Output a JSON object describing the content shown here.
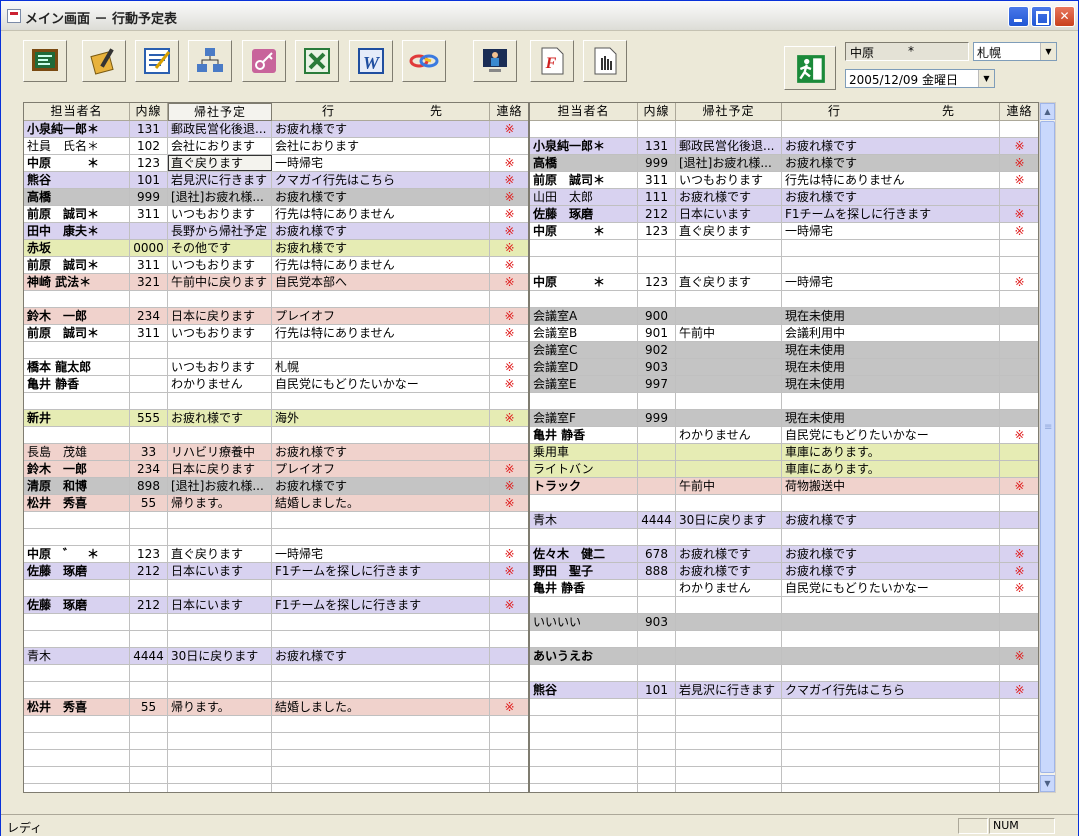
{
  "window": {
    "title": "メイン画面 － 行動予定表"
  },
  "toolbar": {
    "tools": [
      {
        "name": "schedule-board-icon"
      },
      {
        "name": "pen-notebook-icon"
      },
      {
        "name": "checklist-icon"
      },
      {
        "name": "organization-chart-icon"
      },
      {
        "name": "key-icon"
      },
      {
        "name": "excel-icon"
      },
      {
        "name": "word-icon"
      },
      {
        "name": "link-icon"
      },
      {
        "name": "person-monitor-icon"
      },
      {
        "name": "font-document-icon"
      },
      {
        "name": "hand-pointer-icon"
      }
    ],
    "exit_icon": "exit-running-man-icon"
  },
  "header_info": {
    "user_name": "中原",
    "user_mark": "*",
    "location": "札幌",
    "date": "2005/12/09 金曜日"
  },
  "columns": {
    "name": "担当者名",
    "ext": "内線",
    "return": "帰社予定",
    "dest1": "行",
    "dest2": "先",
    "contact": "連絡"
  },
  "left_rows": [
    {
      "bg": "purple",
      "name": "小泉純一郎＊",
      "nb": true,
      "ext": "131",
      "ret": "郵政民営化後退...",
      "dest": "お疲れ様です",
      "mark": "※"
    },
    {
      "bg": "white",
      "name": "社員　氏名＊",
      "nb": false,
      "ext": "102",
      "ret": "会社におります",
      "dest": "会社におります",
      "mark": ""
    },
    {
      "bg": "white",
      "name": "中原　　　＊",
      "nb": true,
      "ext": "123",
      "ret": "直ぐ戻ります",
      "dest": "一時帰宅",
      "mark": "※",
      "boxed": true
    },
    {
      "bg": "purple",
      "name": "熊谷",
      "nb": true,
      "ext": "101",
      "ret": "岩見沢に行きます",
      "dest": "クマガイ行先はこちら",
      "mark": "※"
    },
    {
      "bg": "gray",
      "name": "高橋",
      "nb": true,
      "ext": "999",
      "ret": "[退社]お疲れ様...",
      "dest": "お疲れ様です",
      "mark": "※"
    },
    {
      "bg": "white",
      "name": "前原　誠司＊",
      "nb": true,
      "ext": "311",
      "ret": "いつもおります",
      "dest": "行先は特にありません",
      "mark": "※"
    },
    {
      "bg": "purple",
      "name": "田中　康夫＊",
      "nb": true,
      "ext": "",
      "ret": "長野から帰社予定",
      "dest": "お疲れ様です",
      "mark": "※"
    },
    {
      "bg": "yellow",
      "name": "赤坂",
      "nb": true,
      "ext": "0000",
      "ret": "その他です",
      "dest": "お疲れ様です",
      "mark": "※"
    },
    {
      "bg": "white",
      "name": "前原　誠司＊",
      "nb": true,
      "ext": "311",
      "ret": "いつもおります",
      "dest": "行先は特にありません",
      "mark": "※"
    },
    {
      "bg": "pink",
      "name": "神崎 武法＊",
      "nb": true,
      "ext": "321",
      "ret": "午前中に戻ります",
      "dest": "自民党本部へ",
      "mark": "※"
    },
    {
      "bg": "white",
      "name": "",
      "nb": false,
      "ext": "",
      "ret": "",
      "dest": "",
      "mark": ""
    },
    {
      "bg": "pink",
      "name": "鈴木　一郎",
      "nb": true,
      "ext": "234",
      "ret": "日本に戻ります",
      "dest": "プレイオフ",
      "mark": "※"
    },
    {
      "bg": "white",
      "name": "前原　誠司＊",
      "nb": true,
      "ext": "311",
      "ret": "いつもおります",
      "dest": "行先は特にありません",
      "mark": "※"
    },
    {
      "bg": "white",
      "name": "",
      "nb": false,
      "ext": "",
      "ret": "",
      "dest": "",
      "mark": ""
    },
    {
      "bg": "white",
      "name": "橋本 龍太郎",
      "nb": true,
      "ext": "",
      "ret": "いつもおります",
      "dest": "札幌",
      "mark": "※"
    },
    {
      "bg": "white",
      "name": "亀井 静香",
      "nb": true,
      "ext": "",
      "ret": "わかりません",
      "dest": "自民党にもどりたいかなー",
      "mark": "※"
    },
    {
      "bg": "white",
      "name": "",
      "nb": false,
      "ext": "",
      "ret": "",
      "dest": "",
      "mark": ""
    },
    {
      "bg": "yellow",
      "name": "新井",
      "nb": true,
      "ext": "555",
      "ret": "お疲れ様です",
      "dest": "海外",
      "mark": "※"
    },
    {
      "bg": "white",
      "name": "",
      "nb": false,
      "ext": "",
      "ret": "",
      "dest": "",
      "mark": ""
    },
    {
      "bg": "pink",
      "name": "長島　茂雄",
      "nb": false,
      "ext": "33",
      "ret": "リハビリ療養中",
      "dest": "お疲れ様です",
      "mark": ""
    },
    {
      "bg": "pink",
      "name": "鈴木　一郎",
      "nb": true,
      "ext": "234",
      "ret": "日本に戻ります",
      "dest": "プレイオフ",
      "mark": "※"
    },
    {
      "bg": "gray",
      "name": "清原　和博",
      "nb": true,
      "ext": "898",
      "ret": "[退社]お疲れ様...",
      "dest": "お疲れ様です",
      "mark": "※"
    },
    {
      "bg": "pink",
      "name": "松井　秀喜",
      "nb": true,
      "ext": "55",
      "ret": "帰ります。",
      "dest": "結婚しました。",
      "mark": "※"
    },
    {
      "bg": "white",
      "name": "",
      "nb": false,
      "ext": "",
      "ret": "",
      "dest": "",
      "mark": ""
    },
    {
      "bg": "white",
      "name": "",
      "nb": false,
      "ext": "",
      "ret": "",
      "dest": "",
      "mark": ""
    },
    {
      "bg": "white",
      "name": "中原　゛　＊",
      "nb": true,
      "ext": "123",
      "ret": "直ぐ戻ります",
      "dest": "一時帰宅",
      "mark": "※"
    },
    {
      "bg": "purple",
      "name": "佐藤　琢磨",
      "nb": true,
      "ext": "212",
      "ret": "日本にいます",
      "dest": "F1チームを探しに行きます",
      "mark": "※"
    },
    {
      "bg": "white",
      "name": "",
      "nb": false,
      "ext": "",
      "ret": "",
      "dest": "",
      "mark": ""
    },
    {
      "bg": "purple",
      "name": "佐藤　琢磨",
      "nb": true,
      "ext": "212",
      "ret": "日本にいます",
      "dest": "F1チームを探しに行きます",
      "mark": "※"
    },
    {
      "bg": "white",
      "name": "",
      "nb": false,
      "ext": "",
      "ret": "",
      "dest": "",
      "mark": ""
    },
    {
      "bg": "white",
      "name": "",
      "nb": false,
      "ext": "",
      "ret": "",
      "dest": "",
      "mark": ""
    },
    {
      "bg": "purple",
      "name": "青木",
      "nb": false,
      "ext": "4444",
      "ret": "30日に戻ります",
      "dest": "お疲れ様です",
      "mark": ""
    },
    {
      "bg": "white",
      "name": "",
      "nb": false,
      "ext": "",
      "ret": "",
      "dest": "",
      "mark": ""
    },
    {
      "bg": "white",
      "name": "",
      "nb": false,
      "ext": "",
      "ret": "",
      "dest": "",
      "mark": ""
    },
    {
      "bg": "pink",
      "name": "松井　秀喜",
      "nb": true,
      "ext": "55",
      "ret": "帰ります。",
      "dest": "結婚しました。",
      "mark": "※"
    },
    {
      "bg": "white",
      "name": "",
      "nb": false,
      "ext": "",
      "ret": "",
      "dest": "",
      "mark": ""
    },
    {
      "bg": "white",
      "name": "",
      "nb": false,
      "ext": "",
      "ret": "",
      "dest": "",
      "mark": ""
    },
    {
      "bg": "white",
      "name": "",
      "nb": false,
      "ext": "",
      "ret": "",
      "dest": "",
      "mark": ""
    },
    {
      "bg": "white",
      "name": "",
      "nb": false,
      "ext": "",
      "ret": "",
      "dest": "",
      "mark": ""
    },
    {
      "bg": "white",
      "name": "",
      "nb": false,
      "ext": "",
      "ret": "",
      "dest": "",
      "mark": ""
    },
    {
      "bg": "white",
      "name": "",
      "nb": false,
      "ext": "",
      "ret": "",
      "dest": "",
      "mark": ""
    }
  ],
  "right_rows": [
    {
      "bg": "white",
      "name": "",
      "nb": false,
      "ext": "",
      "ret": "",
      "dest": "",
      "mark": ""
    },
    {
      "bg": "purple",
      "name": "小泉純一郎＊",
      "nb": true,
      "ext": "131",
      "ret": "郵政民営化後退...",
      "dest": "お疲れ様です",
      "mark": "※"
    },
    {
      "bg": "gray",
      "name": "高橋",
      "nb": true,
      "ext": "999",
      "ret": "[退社]お疲れ様...",
      "dest": "お疲れ様です",
      "mark": "※"
    },
    {
      "bg": "white",
      "name": "前原　誠司＊",
      "nb": true,
      "ext": "311",
      "ret": "いつもおります",
      "dest": "行先は特にありません",
      "mark": "※"
    },
    {
      "bg": "purple",
      "name": "山田　太郎",
      "nb": false,
      "ext": "111",
      "ret": "お疲れ様です",
      "dest": "お疲れ様です",
      "mark": ""
    },
    {
      "bg": "purple",
      "name": "佐藤　琢磨",
      "nb": true,
      "ext": "212",
      "ret": "日本にいます",
      "dest": "F1チームを探しに行きます",
      "mark": "※"
    },
    {
      "bg": "white",
      "name": "中原　　　＊",
      "nb": true,
      "ext": "123",
      "ret": "直ぐ戻ります",
      "dest": "一時帰宅",
      "mark": "※"
    },
    {
      "bg": "white",
      "name": "",
      "nb": false,
      "ext": "",
      "ret": "",
      "dest": "",
      "mark": ""
    },
    {
      "bg": "white",
      "name": "",
      "nb": false,
      "ext": "",
      "ret": "",
      "dest": "",
      "mark": ""
    },
    {
      "bg": "white",
      "name": "中原　　　＊",
      "nb": true,
      "ext": "123",
      "ret": "直ぐ戻ります",
      "dest": "一時帰宅",
      "mark": "※"
    },
    {
      "bg": "white",
      "name": "",
      "nb": false,
      "ext": "",
      "ret": "",
      "dest": "",
      "mark": ""
    },
    {
      "bg": "gray",
      "name": "会議室A",
      "nb": false,
      "ext": "900",
      "ret": "",
      "dest": "現在未使用",
      "mark": ""
    },
    {
      "bg": "white",
      "name": "会議室B",
      "nb": false,
      "ext": "901",
      "ret": "午前中",
      "dest": "会議利用中",
      "mark": ""
    },
    {
      "bg": "gray",
      "name": "会議室C",
      "nb": false,
      "ext": "902",
      "ret": "",
      "dest": "現在未使用",
      "mark": ""
    },
    {
      "bg": "gray",
      "name": "会議室D",
      "nb": false,
      "ext": "903",
      "ret": "",
      "dest": "現在未使用",
      "mark": ""
    },
    {
      "bg": "gray",
      "name": "会議室E",
      "nb": false,
      "ext": "997",
      "ret": "",
      "dest": "現在未使用",
      "mark": ""
    },
    {
      "bg": "white",
      "name": "",
      "nb": false,
      "ext": "",
      "ret": "",
      "dest": "",
      "mark": ""
    },
    {
      "bg": "gray",
      "name": "会議室F",
      "nb": false,
      "ext": "999",
      "ret": "",
      "dest": "現在未使用",
      "mark": ""
    },
    {
      "bg": "white",
      "name": "亀井 静香",
      "nb": true,
      "ext": "",
      "ret": "わかりません",
      "dest": "自民党にもどりたいかなー",
      "mark": "※"
    },
    {
      "bg": "yellow",
      "name": "乗用車",
      "nb": false,
      "ext": "",
      "ret": "",
      "dest": "車庫にあります。",
      "mark": ""
    },
    {
      "bg": "yellow",
      "name": "ライトバン",
      "nb": false,
      "ext": "",
      "ret": "",
      "dest": "車庫にあります。",
      "mark": ""
    },
    {
      "bg": "pink",
      "name": "トラック",
      "nb": true,
      "ext": "",
      "ret": "午前中",
      "dest": "荷物搬送中",
      "mark": "※"
    },
    {
      "bg": "white",
      "name": "",
      "nb": false,
      "ext": "",
      "ret": "",
      "dest": "",
      "mark": ""
    },
    {
      "bg": "purple",
      "name": "青木",
      "nb": false,
      "ext": "4444",
      "ret": "30日に戻ります",
      "dest": "お疲れ様です",
      "mark": ""
    },
    {
      "bg": "white",
      "name": "",
      "nb": false,
      "ext": "",
      "ret": "",
      "dest": "",
      "mark": ""
    },
    {
      "bg": "purple",
      "name": "佐々木　健二",
      "nb": true,
      "ext": "678",
      "ret": "お疲れ様です",
      "dest": "お疲れ様です",
      "mark": "※"
    },
    {
      "bg": "purple",
      "name": "野田　聖子",
      "nb": true,
      "ext": "888",
      "ret": "お疲れ様です",
      "dest": "お疲れ様です",
      "mark": "※"
    },
    {
      "bg": "white",
      "name": "亀井 静香",
      "nb": true,
      "ext": "",
      "ret": "わかりません",
      "dest": "自民党にもどりたいかなー",
      "mark": "※"
    },
    {
      "bg": "white",
      "name": "",
      "nb": false,
      "ext": "",
      "ret": "",
      "dest": "",
      "mark": ""
    },
    {
      "bg": "gray",
      "name": "いいいい",
      "nb": false,
      "ext": "903",
      "ret": "",
      "dest": "",
      "mark": ""
    },
    {
      "bg": "white",
      "name": "",
      "nb": false,
      "ext": "",
      "ret": "",
      "dest": "",
      "mark": ""
    },
    {
      "bg": "gray",
      "name": "あいうえお",
      "nb": true,
      "ext": "",
      "ret": "",
      "dest": "",
      "mark": "※"
    },
    {
      "bg": "white",
      "name": "",
      "nb": false,
      "ext": "",
      "ret": "",
      "dest": "",
      "mark": ""
    },
    {
      "bg": "purple",
      "name": "熊谷",
      "nb": true,
      "ext": "101",
      "ret": "岩見沢に行きます",
      "dest": "クマガイ行先はこちら",
      "mark": "※"
    },
    {
      "bg": "white",
      "name": "",
      "nb": false,
      "ext": "",
      "ret": "",
      "dest": "",
      "mark": ""
    },
    {
      "bg": "white",
      "name": "",
      "nb": false,
      "ext": "",
      "ret": "",
      "dest": "",
      "mark": ""
    },
    {
      "bg": "white",
      "name": "",
      "nb": false,
      "ext": "",
      "ret": "",
      "dest": "",
      "mark": ""
    },
    {
      "bg": "white",
      "name": "",
      "nb": false,
      "ext": "",
      "ret": "",
      "dest": "",
      "mark": ""
    },
    {
      "bg": "white",
      "name": "",
      "nb": false,
      "ext": "",
      "ret": "",
      "dest": "",
      "mark": ""
    },
    {
      "bg": "white",
      "name": "",
      "nb": false,
      "ext": "",
      "ret": "",
      "dest": "",
      "mark": ""
    },
    {
      "bg": "white",
      "name": "",
      "nb": false,
      "ext": "",
      "ret": "",
      "dest": "",
      "mark": ""
    }
  ],
  "status": {
    "text": "レディ",
    "num": "NUM"
  },
  "colors": {
    "purple_row": "#d8d2f0",
    "gray_row": "#c4c4c4",
    "pink_row": "#f0d2cc",
    "yellow_row": "#e6ecb4",
    "contact_mark": "#e02020"
  }
}
